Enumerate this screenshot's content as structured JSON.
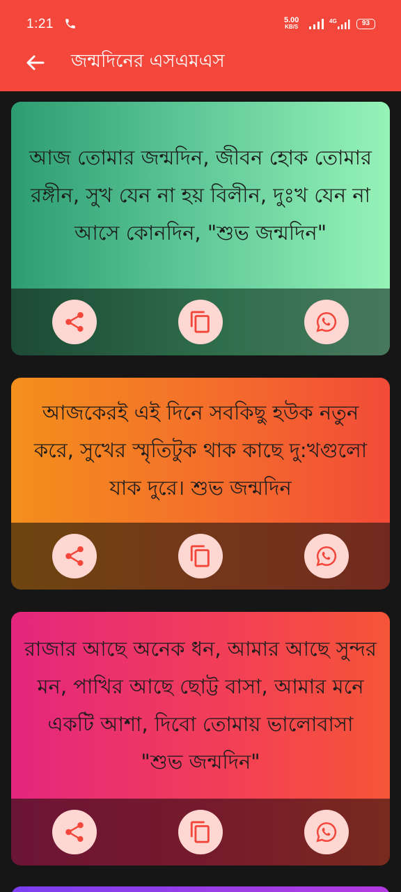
{
  "status_bar": {
    "time": "1:21",
    "net_speed_value": "5.00",
    "net_speed_unit": "KB/S",
    "network_type": "4G",
    "battery": "93"
  },
  "app_bar": {
    "title": "জন্মদিনের এসএমএস",
    "back_icon": "arrow-left-icon"
  },
  "messages": [
    {
      "text": "আজ তোমার জন্মদিন, জীবন হোক তোমার রঙ্গীন, সুখ যেন না হয় বিলীন, দুঃখ যেন না আসে কোনদিন, \"শুভ জন্মদিন\""
    },
    {
      "text": "আজকেরই এই দিনে সবকিছু হউক নতুন করে, সুখের স্মৃতিটুক থাক কাছে দু:খগুলো যাক দুরে। শুভ জন্মদিন"
    },
    {
      "text": "রাজার আছে অনেক ধন, আমার আছে সুন্দর মন, পাখির আছে ছোট্ট বাসা, আমার মনে একটি আশা, দিবো তোমায় ভালোবাসা \"শুভ জন্মদিন\""
    }
  ],
  "card_actions": {
    "share_icon": "share-icon",
    "copy_icon": "copy-icon",
    "whatsapp_icon": "whatsapp-icon"
  },
  "colors": {
    "app_bar": "#f2473a",
    "background": "#161616",
    "action_button": "#ffd7d2",
    "icon": "#f2473a"
  }
}
